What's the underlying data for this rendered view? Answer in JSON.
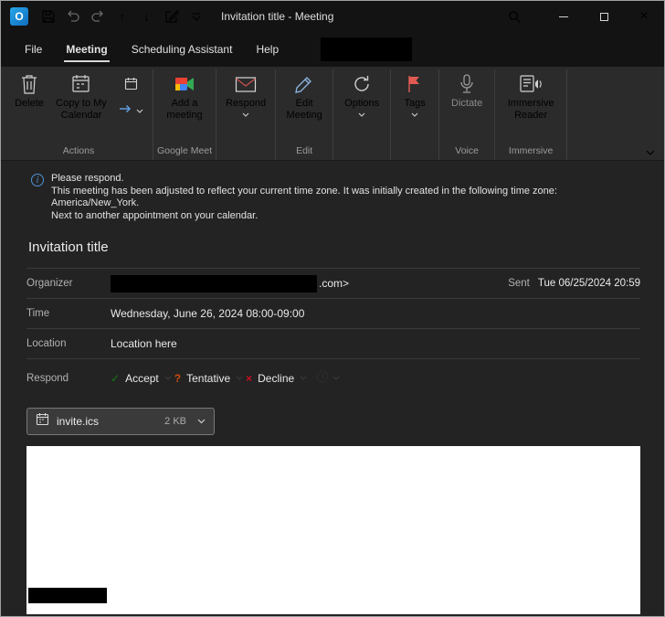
{
  "titlebar": {
    "title": "Invitation title - Meeting"
  },
  "tabs": {
    "items": [
      {
        "label": "File"
      },
      {
        "label": "Meeting"
      },
      {
        "label": "Scheduling Assistant"
      },
      {
        "label": "Help"
      }
    ]
  },
  "ribbon": {
    "buttons": {
      "delete": "Delete",
      "copy_to_my_calendar": "Copy to My Calendar",
      "add_a_meeting": "Add a meeting",
      "respond": "Respond",
      "edit_meeting": "Edit Meeting",
      "options": "Options",
      "tags": "Tags",
      "dictate": "Dictate",
      "immersive_reader": "Immersive Reader"
    },
    "groups": {
      "actions": "Actions",
      "google_meet": "Google Meet",
      "edit": "Edit",
      "voice": "Voice",
      "immersive": "Immersive"
    }
  },
  "info_bar": {
    "lines": [
      "Please respond.",
      "This meeting has been adjusted to reflect your current time zone. It was initially created in the following time zone:",
      "America/New_York.",
      "Next to another appointment on your calendar."
    ]
  },
  "meeting": {
    "title": "Invitation title",
    "organizer_label": "Organizer",
    "organizer_visible": ".com>",
    "sent_label": "Sent",
    "sent_value": "Tue 06/25/2024 20:59",
    "time_label": "Time",
    "time_value": "Wednesday, June 26, 2024 08:00-09:00",
    "location_label": "Location",
    "location_value": "Location here",
    "respond_label": "Respond",
    "respond_buttons": {
      "accept": "Accept",
      "tentative": "Tentative",
      "decline": "Decline"
    }
  },
  "attachment": {
    "name": "invite.ics",
    "size": "2 KB"
  },
  "icons": {
    "outlook_logo": "O",
    "info": "i",
    "up_arrow": "↑",
    "down_arrow": "↓",
    "close": "×",
    "accept_check": "✓",
    "tentative_question": "?",
    "decline_x": "×"
  }
}
